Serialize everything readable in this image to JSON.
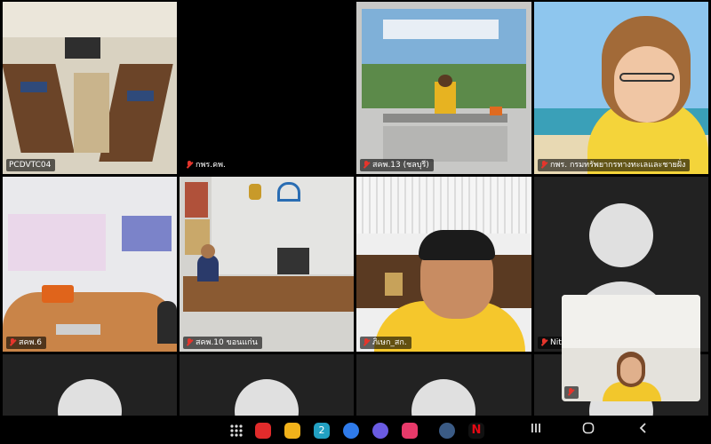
{
  "meeting": {
    "participants": [
      {
        "name": "PCDVTC04",
        "muted": false
      },
      {
        "name": "กพร.คพ.",
        "muted": true
      },
      {
        "name": "สคพ.13 (ชลบุรี)",
        "muted": true
      },
      {
        "name": "กพร. กรมทรัพยากรทางทะเลและชายฝั่ง",
        "muted": true
      },
      {
        "name": "สคพ.6",
        "muted": true
      },
      {
        "name": "สคพ.10 ขอนแก่น",
        "muted": true
      },
      {
        "name": "ภิเษก_สก.",
        "muted": true
      },
      {
        "name": "Nit",
        "muted": true
      }
    ]
  },
  "taskbar": {
    "apps": [
      "app-drawer-icon",
      "flipboard-icon",
      "folder-icon",
      "calendar-icon",
      "messages-icon",
      "internet-icon",
      "camera-icon",
      "settings-icon",
      "netflix-icon"
    ],
    "nav": [
      "recents-icon",
      "home-icon",
      "back-icon"
    ],
    "calendar_day": "2",
    "netflix_letter": "N"
  }
}
